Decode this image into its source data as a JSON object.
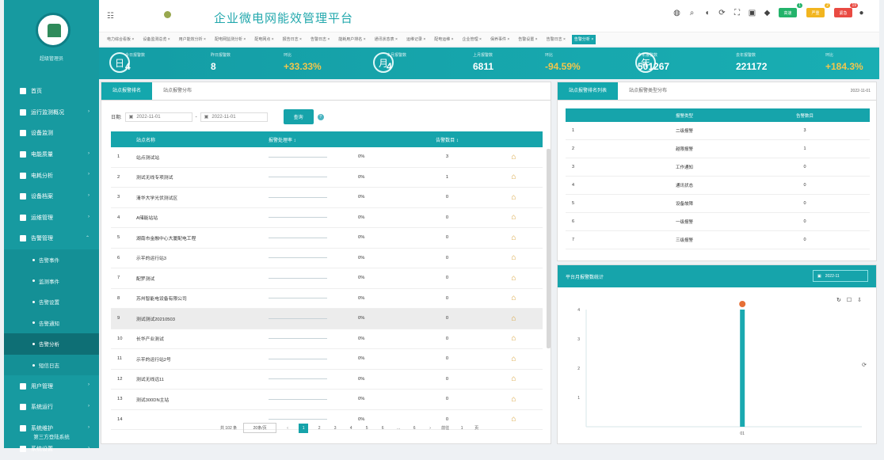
{
  "header": {
    "title": "企业微电网能效管理平台",
    "badges": [
      {
        "label": "高速",
        "count": "1",
        "color": "#23b36b"
      },
      {
        "label": "严重",
        "count": "2",
        "color": "#f2b51f"
      },
      {
        "label": "紧急",
        "count": "19",
        "color": "#e94a42"
      }
    ]
  },
  "tabs": [
    "电力综合看板",
    "设备监测总览",
    "用户能效分析",
    "配电网监测分析",
    "配电网点",
    "报告日志",
    "告警日志",
    "能耗用户排名",
    "通讯状态表",
    "运维记录",
    "配电运维",
    "企业管理",
    "保养事件",
    "告警设置",
    "告警日志",
    "告警分析"
  ],
  "stats": [
    {
      "symbol": "日",
      "label": "今日报警数",
      "value": "4"
    },
    {
      "label": "昨日报警数",
      "value": "8"
    },
    {
      "label": "环比",
      "value": "+33.33%",
      "highlight": true
    },
    {
      "symbol": "月",
      "label": "本月报警数",
      "value": "4"
    },
    {
      "label": "上月报警数",
      "value": "6811"
    },
    {
      "label": "环比",
      "value": "-94.59%",
      "highlight": true
    },
    {
      "symbol": "年",
      "label": "今年报警数",
      "value": "501267"
    },
    {
      "label": "去年报警数",
      "value": "221172"
    },
    {
      "label": "环比",
      "value": "+184.3%",
      "highlight": true
    }
  ],
  "sidebar": {
    "subtitle": "超级管理员",
    "items": [
      {
        "label": "首页",
        "arrow": ""
      },
      {
        "label": "运行监测概况",
        "arrow": "›"
      },
      {
        "label": "设备监测",
        "arrow": ""
      },
      {
        "label": "电能质量",
        "arrow": "›"
      },
      {
        "label": "电耗分析",
        "arrow": "›"
      },
      {
        "label": "设备档案",
        "arrow": "›"
      },
      {
        "label": "运维管理",
        "arrow": "›"
      },
      {
        "label": "告警管理",
        "arrow": "⌃"
      }
    ],
    "subitems": [
      {
        "label": "告警事件",
        "active": false
      },
      {
        "label": "监测事件",
        "active": false
      },
      {
        "label": "告警设置",
        "active": false
      },
      {
        "label": "告警通知",
        "active": false
      },
      {
        "label": "告警分析",
        "active": true
      },
      {
        "label": "短信日志",
        "active": false
      }
    ],
    "tail_items": [
      {
        "label": "用户管理",
        "arrow": "›"
      },
      {
        "label": "系统运行",
        "arrow": "›"
      },
      {
        "label": "系统维护",
        "arrow": "›"
      },
      {
        "label": "系统设置",
        "arrow": "›"
      }
    ],
    "footer": "第三方登陆系统"
  },
  "left_panel": {
    "tabs": [
      "站点报警排名",
      "站点报警分布"
    ],
    "filter_label": "日期:",
    "start_date": "2022-11-01",
    "end_date": "2022-11-01",
    "query_label": "查询",
    "help_icon": "?",
    "columns": [
      "站点名称",
      "报警处理率 ↕",
      "告警数目 ↕",
      ""
    ],
    "rows": [
      {
        "no": "1",
        "name": "站点测试站",
        "rate": "0%",
        "count": "3"
      },
      {
        "no": "2",
        "name": "测试无线专项测试",
        "rate": "0%",
        "count": "1"
      },
      {
        "no": "3",
        "name": "清华大学光伏测试区",
        "rate": "0%",
        "count": "0"
      },
      {
        "no": "4",
        "name": "A储能站站",
        "rate": "0%",
        "count": "0"
      },
      {
        "no": "5",
        "name": "湖南市金融中心大厦配电工程",
        "rate": "0%",
        "count": "0"
      },
      {
        "no": "6",
        "name": "示平的运行站3",
        "rate": "0%",
        "count": "0"
      },
      {
        "no": "7",
        "name": "配罗测试",
        "rate": "0%",
        "count": "0"
      },
      {
        "no": "8",
        "name": "苏州智能电设备有限公司",
        "rate": "0%",
        "count": "0"
      },
      {
        "no": "9",
        "name": "测试测试20210503",
        "rate": "0%",
        "count": "0",
        "selected": true
      },
      {
        "no": "10",
        "name": "长华产业测试",
        "rate": "0%",
        "count": "0"
      },
      {
        "no": "11",
        "name": "示平的运行站2号",
        "rate": "0%",
        "count": "0"
      },
      {
        "no": "12",
        "name": "测试无线远11",
        "rate": "0%",
        "count": "0"
      },
      {
        "no": "13",
        "name": "测试300DN主站",
        "rate": "0%",
        "count": "0"
      },
      {
        "no": "14",
        "name": "",
        "rate": "0%",
        "count": "0"
      }
    ],
    "pagination": {
      "total": "共 102 条",
      "size": "20条/页",
      "pages": [
        "1",
        "2",
        "3",
        "4",
        "5",
        "6",
        "…",
        "6"
      ],
      "goto": "前往",
      "page": "1",
      "suffix": "页"
    }
  },
  "right_panel": {
    "tabs": [
      "站点报警排名列表",
      "站点报警类型分布"
    ],
    "date": "2022-11-01",
    "columns": [
      "",
      "报警类型",
      "告警数目"
    ],
    "rows": [
      {
        "no": "1",
        "type": "二级报警",
        "count": "3"
      },
      {
        "no": "2",
        "type": "越限报警",
        "count": "1"
      },
      {
        "no": "3",
        "type": "工作通知",
        "count": "0"
      },
      {
        "no": "4",
        "type": "通讯状态",
        "count": "0"
      },
      {
        "no": "5",
        "type": "设备故障",
        "count": "0"
      },
      {
        "no": "6",
        "type": "一级报警",
        "count": "0"
      },
      {
        "no": "7",
        "type": "三级报警",
        "count": "0"
      }
    ]
  },
  "chart": {
    "title": "平台月报警数统计",
    "date": "2022-11",
    "chart_data": {
      "type": "bar",
      "categories": [
        "01"
      ],
      "values": [
        4
      ],
      "title": "平台月报警数统计",
      "xlabel": "",
      "ylabel": "",
      "ylim": [
        0,
        4
      ]
    }
  },
  "colors": {
    "accent": "#16a4ab",
    "sidebar": "#179aa0",
    "gold": "#f2c64d"
  }
}
